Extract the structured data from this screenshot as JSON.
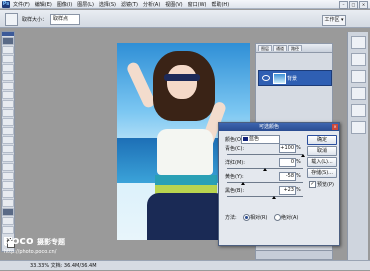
{
  "menubar": {
    "logo": "Ps",
    "items": [
      "文件(F)",
      "编辑(E)",
      "图像(I)",
      "图层(L)",
      "选择(S)",
      "滤镜(T)",
      "分析(A)",
      "视图(V)",
      "窗口(W)",
      "帮助(H)"
    ],
    "controls": [
      "–",
      "□",
      "×"
    ]
  },
  "options": {
    "label": "取样大小：",
    "value": "取样点",
    "workspace": "工作区 ▾"
  },
  "layers_panel": {
    "tabs": [
      "图层",
      "通道",
      "路径"
    ],
    "layer_name": "背景"
  },
  "dialog": {
    "title": "可选颜色",
    "colors_label": "颜色(O):",
    "colors_value": "蓝色",
    "colors_swatch": "#10217a",
    "rows": [
      {
        "label": "青色(C):",
        "value": "+100",
        "unit": "%",
        "level": 1.0
      },
      {
        "label": "洋红(M):",
        "value": "0",
        "unit": "%",
        "level": 0.5
      },
      {
        "label": "黄色(Y):",
        "value": "-58",
        "unit": "%",
        "level": 0.21
      },
      {
        "label": "黑色(B):",
        "value": "+23",
        "unit": "%",
        "level": 0.615
      }
    ],
    "buttons": {
      "ok": "确定",
      "cancel": "取消",
      "load": "载入(L)...",
      "save": "存储(S)..."
    },
    "preview_label": "预览(P)",
    "method_label": "方法:",
    "relative_label": "相对(R)",
    "absolute_label": "绝对(A)"
  },
  "watermark": {
    "logo": "poco",
    "brand": "摄影专题",
    "url": "http://photo.poco.cn/"
  },
  "status": "33.33%  文档: 36.4M/36.4M"
}
